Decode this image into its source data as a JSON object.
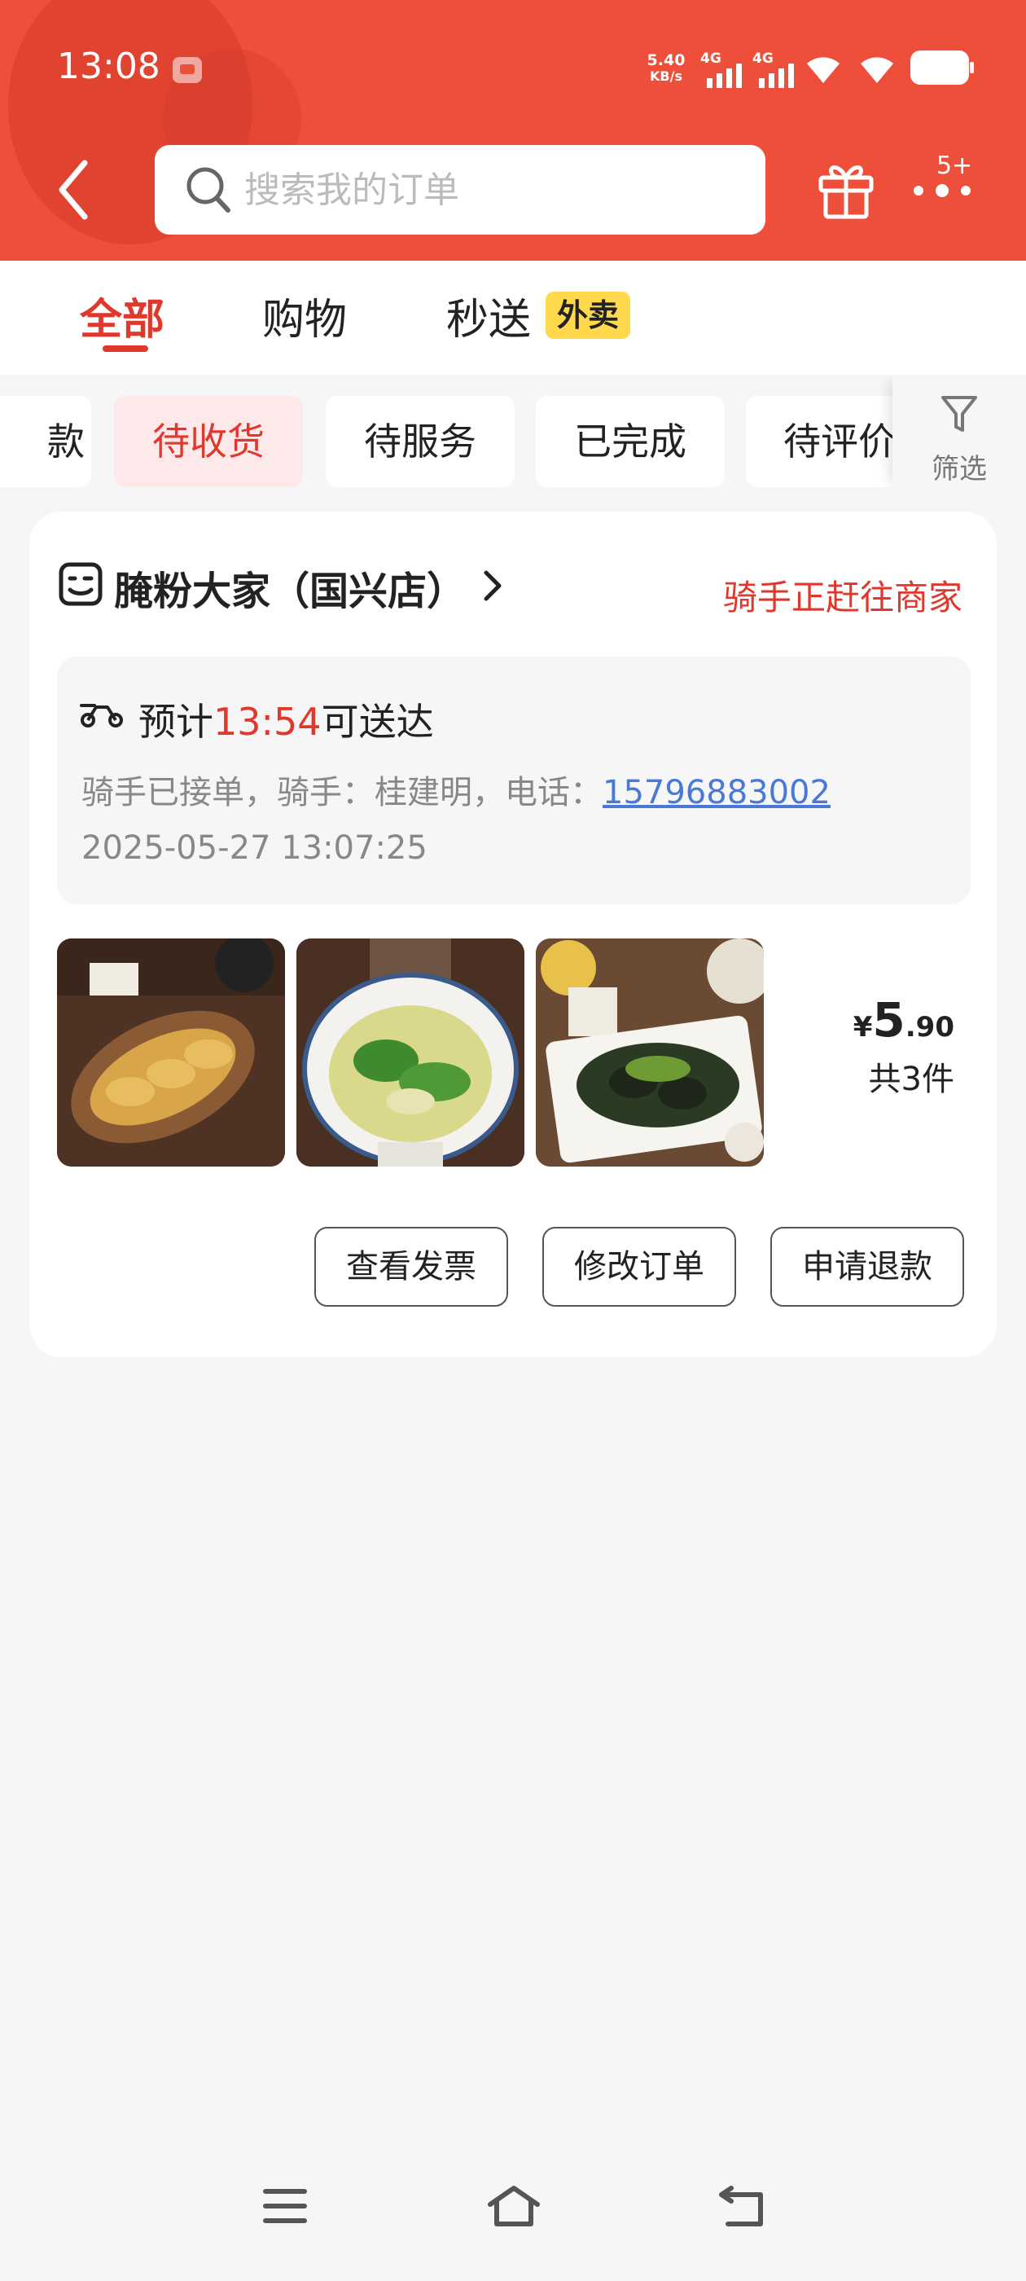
{
  "status_bar": {
    "time": "13:08",
    "net_speed_value": "5.40",
    "net_speed_unit": "KB/s",
    "signal_1": "4G",
    "signal_2": "4G"
  },
  "header": {
    "search_placeholder": "搜索我的订单",
    "more_badge": "5+"
  },
  "tabs": {
    "all": "全部",
    "shopping": "购物",
    "express": "秒送",
    "express_tag": "外卖"
  },
  "filters": {
    "chips": [
      "款",
      "待收货",
      "待服务",
      "已完成",
      "待评价"
    ],
    "filter_label": "筛选"
  },
  "order": {
    "shop_name": "腌粉大家（国兴店）",
    "status": "骑手正赶往商家",
    "eta_prefix": "预计",
    "eta_time": "13:54",
    "eta_suffix": "可送达",
    "rider_info": "骑手已接单，骑手：桂建明，电话：",
    "rider_phone": "15796883002",
    "order_time": "2025-05-27 13:07:25",
    "price_symbol": "¥",
    "price_int": "5",
    "price_dec": ".90",
    "quantity": "共3件",
    "buttons": {
      "invoice": "查看发票",
      "modify": "修改订单",
      "refund": "申请退款"
    }
  },
  "colors": {
    "brand_red": "#ee4f3a",
    "accent_red": "#e0382c",
    "tag_yellow": "#ffd84b",
    "link_blue": "#4a78d6"
  }
}
